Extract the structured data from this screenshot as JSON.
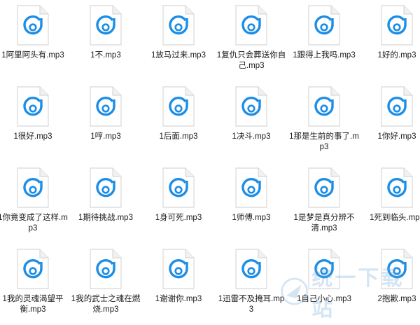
{
  "colors": {
    "accent": "#1c8ee6",
    "page_fold": "#d8d8d8",
    "text": "#1a1a1a"
  },
  "file_icon": "groove-music-file-icon",
  "files": [
    {
      "name": "1阿里阿头有.mp3"
    },
    {
      "name": "1不.mp3"
    },
    {
      "name": "1放马过来.mp3"
    },
    {
      "name": "1复仇只会葬送你自己.mp3"
    },
    {
      "name": "1跟得上我吗.mp3"
    },
    {
      "name": "1好的.mp3"
    },
    {
      "name": "1很好.mp3"
    },
    {
      "name": "1哼.mp3"
    },
    {
      "name": "1后面.mp3"
    },
    {
      "name": "1决斗.mp3"
    },
    {
      "name": "1那是生前的事了.mp3"
    },
    {
      "name": "1你好.mp3"
    },
    {
      "name": "1你竟变成了这样.mp3"
    },
    {
      "name": "1期待挑战.mp3"
    },
    {
      "name": "1身可死.mp3"
    },
    {
      "name": "1师傅.mp3"
    },
    {
      "name": "1是梦是真分辨不清.mp3"
    },
    {
      "name": "1死到临头.mp3"
    },
    {
      "name": "1我的灵魂渴望平衡.mp3"
    },
    {
      "name": "1我的武士之魂在燃烧.mp3"
    },
    {
      "name": "1谢谢你.mp3"
    },
    {
      "name": "1迅雷不及掩耳.mp3"
    },
    {
      "name": "1自己小心.mp3"
    },
    {
      "name": "2抱歉.mp3"
    }
  ],
  "watermark": {
    "text": "统一下载站",
    "icon": "watermark-logo-icon"
  }
}
